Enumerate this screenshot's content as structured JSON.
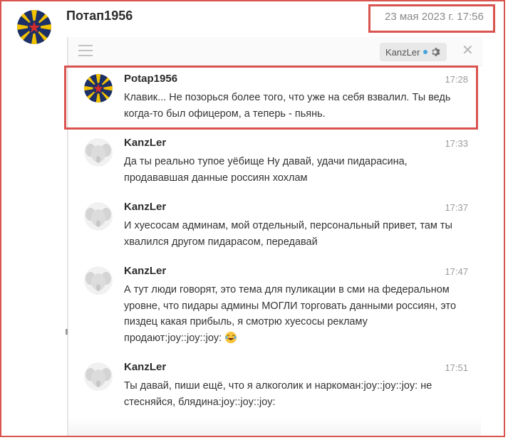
{
  "post": {
    "author": "Потап1956",
    "date": "23 мая 2023 г. 17:56"
  },
  "chat_panel": {
    "user_chip_label": "KanzLer",
    "menu_icon": "hamburger-icon",
    "settings_icon": "gear-icon",
    "close_icon": "close-icon",
    "close_glyph": "✕",
    "messages": [
      {
        "author": "Potap1956",
        "time": "17:28",
        "text": "Клавик... Не позорься более того, что уже на себя взвалил. Ты ведь когда-то был офицером, а теперь - пьянь."
      },
      {
        "author": "KanzLer",
        "time": "17:33",
        "text": "Да ты реально тупое уёбище Ну давай, удачи пидарасина, продававшая данные россиян хохлам"
      },
      {
        "author": "KanzLer",
        "time": "17:37",
        "text": "И хуесосам админам, мой отдельный, персональный привет, там ты хвалился другом пидарасом, передавай"
      },
      {
        "author": "KanzLer",
        "time": "17:47",
        "text": "А тут люди говорят, это тема для пуликации в сми на федеральном уровне, что пидары админы МОГЛИ торговать данными россиян, это пиздец какая прибыль, я смотрю хуесосы рекламу продают:joy::joy::joy:"
      },
      {
        "author": "KanzLer",
        "time": "17:51",
        "text": "Ты давай, пиши ещё, что я алкоголик и наркоман:joy::joy::joy: не стесняйся, блядина:joy::joy::joy:"
      }
    ]
  },
  "colors": {
    "highlight_border": "#d9534f",
    "accent_dot": "#4aa3df",
    "muted_text": "#9a9a9a"
  }
}
